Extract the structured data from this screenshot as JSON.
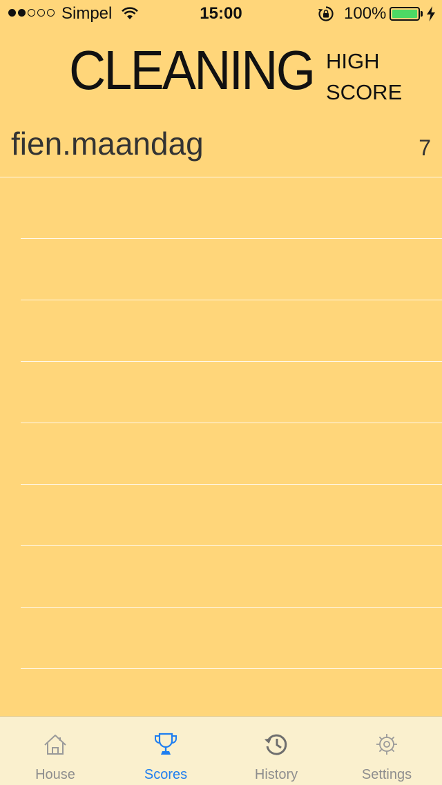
{
  "status_bar": {
    "carrier": "Simpel",
    "time": "15:00",
    "battery_percent": "100%",
    "signal_strength_dots": 2,
    "signal_total_dots": 5,
    "battery_level": 1.0,
    "battery_color": "#4CD964"
  },
  "header": {
    "title": "CLEANING",
    "subtitle_line1": "HIGH",
    "subtitle_line2": "SCORE"
  },
  "scores": [
    {
      "name": "fien.maandag",
      "score": "7"
    },
    {
      "name": "",
      "score": ""
    },
    {
      "name": "",
      "score": ""
    },
    {
      "name": "",
      "score": ""
    },
    {
      "name": "",
      "score": ""
    },
    {
      "name": "",
      "score": ""
    },
    {
      "name": "",
      "score": ""
    },
    {
      "name": "",
      "score": ""
    },
    {
      "name": "",
      "score": ""
    },
    {
      "name": "",
      "score": ""
    }
  ],
  "tabs": [
    {
      "label": "House",
      "icon": "house-icon",
      "active": false
    },
    {
      "label": "Scores",
      "icon": "trophy-icon",
      "active": true
    },
    {
      "label": "History",
      "icon": "history-icon",
      "active": false
    },
    {
      "label": "Settings",
      "icon": "gear-icon",
      "active": false
    }
  ],
  "colors": {
    "background": "#FFD67A",
    "tab_bar": "#FAF0CE",
    "accent": "#1E7EF0",
    "inactive": "#8E8E8E"
  }
}
